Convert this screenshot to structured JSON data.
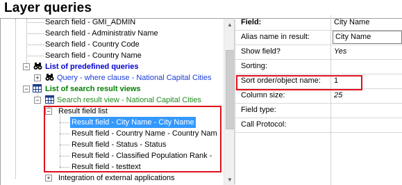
{
  "window": {
    "title": "Layer queries"
  },
  "tree": {
    "items": [
      {
        "label": "Search field - GMI_ADMIN"
      },
      {
        "label": "Search field - Administrativ Name"
      },
      {
        "label": "Search field - Country Code"
      },
      {
        "label": "Search field - Country Name"
      },
      {
        "label": "List of predefined queries"
      },
      {
        "label": "Query - where clause - National Capital Cities"
      },
      {
        "label": "List of search result views"
      },
      {
        "label": "Search result view - National Capital Cities"
      },
      {
        "label": "Result field list"
      },
      {
        "label": "Result field - City Name - City Name"
      },
      {
        "label": "Result field - Country Name - Country Nam"
      },
      {
        "label": "Result field - Status - Status"
      },
      {
        "label": "Result field - Classified Population Rank -"
      },
      {
        "label": "Result field - testtext"
      },
      {
        "label": "Integration of external applications"
      }
    ],
    "expander_minus": "−",
    "expander_plus": "+"
  },
  "properties": {
    "rows": [
      {
        "label": "Field:",
        "value": "City Name"
      },
      {
        "label": "Alias name in result:",
        "value": "City Name"
      },
      {
        "label": "Show field?",
        "value": "Yes"
      },
      {
        "label": "Sorting:",
        "value": ""
      },
      {
        "label": "Sort order/object name:",
        "value": "1"
      },
      {
        "label": "Column size:",
        "value": "25"
      },
      {
        "label": "Field type:",
        "value": ""
      },
      {
        "label": "Call Protocol:",
        "value": ""
      }
    ]
  },
  "colors": {
    "highlight": "#e0101e",
    "selection": "#3399ff",
    "category_blue": "#0000d0",
    "category_green": "#008000"
  }
}
